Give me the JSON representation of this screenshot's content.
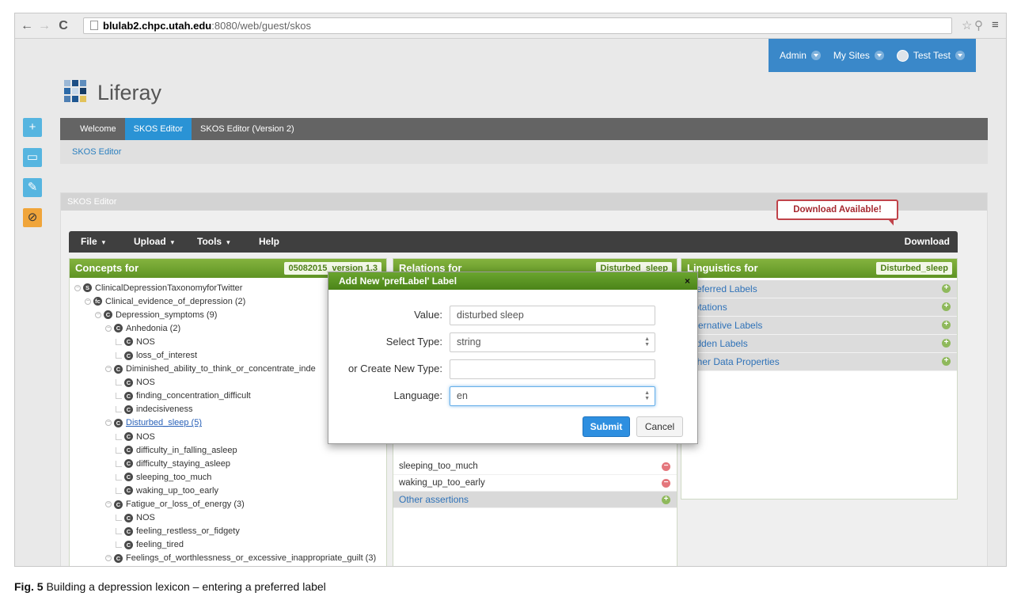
{
  "browser": {
    "url_host": "blulab2.chpc.utah.edu",
    "url_rest": ":8080/web/guest/skos"
  },
  "dock": {
    "admin": "Admin",
    "my_sites": "My Sites",
    "user": "Test Test"
  },
  "logo_text": "Liferay",
  "nav_tabs": [
    "Welcome",
    "SKOS Editor",
    "SKOS Editor (Version 2)"
  ],
  "breadcrumb": "SKOS Editor",
  "portlet_title": "SKOS Editor",
  "download_note": "Download Available!",
  "menubar": {
    "file": "File",
    "upload": "Upload",
    "tools": "Tools",
    "help": "Help",
    "download": "Download"
  },
  "concepts": {
    "title": "Concepts for",
    "badge": "05082015_version 1.3",
    "tree": [
      {
        "indent": 0,
        "badge": "S",
        "label": "ClinicalDepressionTaxonomyforTwitter",
        "toggle": true
      },
      {
        "indent": 1,
        "badge": "fc",
        "label": "Clinical_evidence_of_depression (2)",
        "toggle": true
      },
      {
        "indent": 2,
        "badge": "C",
        "label": "Depression_symptoms (9)",
        "toggle": true
      },
      {
        "indent": 3,
        "badge": "C",
        "label": "Anhedonia (2)",
        "toggle": true
      },
      {
        "indent": 4,
        "badge": "C",
        "label": "NOS",
        "toggle": false
      },
      {
        "indent": 4,
        "badge": "C",
        "label": "loss_of_interest",
        "toggle": false
      },
      {
        "indent": 3,
        "badge": "C",
        "label": "Diminished_ability_to_think_or_concentrate_inde",
        "toggle": true
      },
      {
        "indent": 4,
        "badge": "C",
        "label": "NOS",
        "toggle": false
      },
      {
        "indent": 4,
        "badge": "C",
        "label": "finding_concentration_difficult",
        "toggle": false
      },
      {
        "indent": 4,
        "badge": "C",
        "label": "indecisiveness",
        "toggle": false
      },
      {
        "indent": 3,
        "badge": "C",
        "label": "Disturbed_sleep (5)",
        "toggle": true,
        "link": true
      },
      {
        "indent": 4,
        "badge": "C",
        "label": "NOS",
        "toggle": false
      },
      {
        "indent": 4,
        "badge": "C",
        "label": "difficulty_in_falling_asleep",
        "toggle": false
      },
      {
        "indent": 4,
        "badge": "C",
        "label": "difficulty_staying_asleep",
        "toggle": false
      },
      {
        "indent": 4,
        "badge": "C",
        "label": "sleeping_too_much",
        "toggle": false
      },
      {
        "indent": 4,
        "badge": "C",
        "label": "waking_up_too_early",
        "toggle": false
      },
      {
        "indent": 3,
        "badge": "C",
        "label": "Fatigue_or_loss_of_energy (3)",
        "toggle": true
      },
      {
        "indent": 4,
        "badge": "C",
        "label": "NOS",
        "toggle": false
      },
      {
        "indent": 4,
        "badge": "C",
        "label": "feeling_restless_or_fidgety",
        "toggle": false
      },
      {
        "indent": 4,
        "badge": "C",
        "label": "feeling_tired",
        "toggle": false
      },
      {
        "indent": 3,
        "badge": "C",
        "label": "Feelings_of_worthlessness_or_excessive_inappropriate_guilt (3)",
        "toggle": true
      }
    ]
  },
  "relations": {
    "title": "Relations for",
    "badge": "Disturbed_sleep",
    "rows": [
      {
        "label": "sleeping_too_much",
        "icon": "minus"
      },
      {
        "label": "waking_up_too_early",
        "icon": "minus"
      }
    ],
    "section": "Other assertions"
  },
  "linguistics": {
    "title": "Linguistics for",
    "badge": "Disturbed_sleep",
    "rows": [
      "Preferred Labels",
      "Notations",
      "Alternative Labels",
      "Hidden Labels",
      "Other Data Properties"
    ]
  },
  "modal": {
    "title": "Add New 'prefLabel' Label",
    "close": "×",
    "value_label": "Value:",
    "value": "disturbed sleep",
    "type_label": "Select Type:",
    "type_value": "string",
    "new_type_label": "or Create New Type:",
    "new_type_value": "",
    "language_label": "Language:",
    "language_value": "en",
    "submit": "Submit",
    "cancel": "Cancel"
  },
  "caption": {
    "fig": "Fig. 5",
    "text": "Building a depression lexicon – entering a preferred label"
  }
}
